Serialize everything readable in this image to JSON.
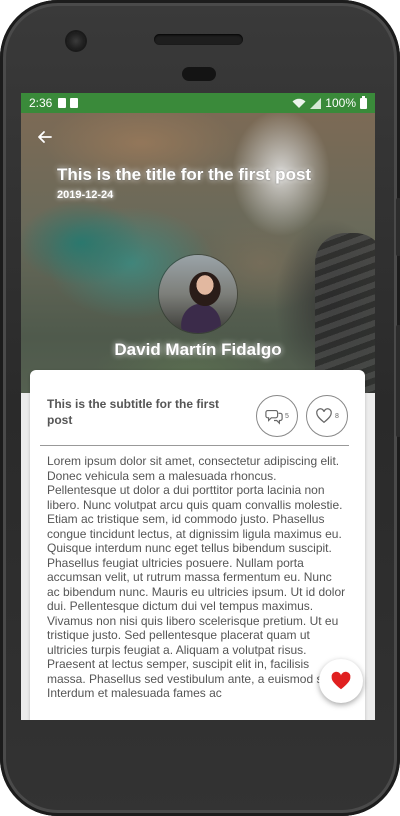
{
  "status_bar": {
    "time": "2:36",
    "battery_text": "100%"
  },
  "post": {
    "title": "This is the title for the first post",
    "date": "2019-12-24",
    "author": "David Martín Fidalgo",
    "subtitle": "This is the subtitle for the first post",
    "comments_count": "5",
    "likes_count": "8",
    "body": "Lorem ipsum dolor sit amet, consectetur adipiscing elit. Donec vehicula sem a malesuada rhoncus. Pellentesque ut dolor a dui porttitor porta lacinia non libero. Nunc volutpat arcu quis quam convallis molestie. Etiam ac tristique sem, id commodo justo. Phasellus congue tincidunt lectus, at dignissim ligula maximus eu. Quisque interdum nunc eget tellus bibendum suscipit. Phasellus feugiat ultricies posuere. Nullam porta accumsan velit, ut rutrum massa fermentum eu. Nunc ac bibendum nunc. Mauris eu ultricies ipsum. Ut id dolor dui. Pellentesque dictum dui vel tempus maximus. Vivamus non nisi quis libero scelerisque pretium. Ut eu tristique justo. Sed pellentesque placerat quam ut ultricies turpis feugiat a. Aliquam a volutpat risus. Praesent at lectus semper, suscipit elit in, facilisis massa. Phasellus sed vestibulum ante, a euismod sem. Interdum et malesuada fames ac"
  },
  "colors": {
    "status_bar": "#3a8a3a",
    "heart": "#e02020"
  },
  "icons": {
    "back": "arrow-back-icon",
    "comments": "comments-icon",
    "likes": "heart-outline-icon",
    "fab": "heart-filled-icon"
  }
}
